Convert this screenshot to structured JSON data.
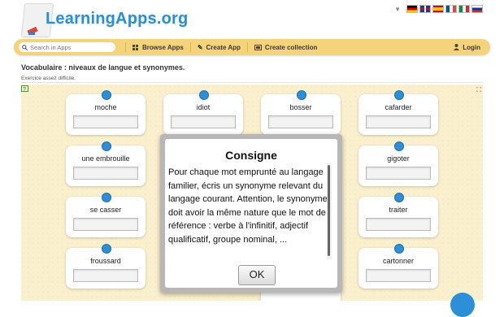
{
  "header": {
    "brand": "LearningApps.org",
    "language_flags": [
      "german-flag",
      "uk-flag",
      "spanish-flag",
      "french-flag",
      "italian-flag",
      "russian-flag"
    ]
  },
  "toolbar": {
    "search_placeholder": "Search in Apps",
    "browse_label": "Browse Apps",
    "create_label": "Create App",
    "collection_label": "Create collection",
    "login_label": "Login"
  },
  "page": {
    "title": "Vocabulaire : niveaux de langue et synonymes.",
    "subtitle": "Exercice assez difficile."
  },
  "cards": [
    {
      "word": "moche"
    },
    {
      "word": "idiot"
    },
    {
      "word": "bosser"
    },
    {
      "word": "cafarder"
    },
    {
      "word": "une embrouille"
    },
    {
      "word": "gigoter"
    },
    {
      "word": "se casser"
    },
    {
      "word": "traiter"
    },
    {
      "word": "froussard"
    },
    {
      "word": "cartonner"
    }
  ],
  "dialog": {
    "title": "Consigne",
    "text": "Pour chaque mot emprunté au langage familier, écris un synonyme relevant du langage courant. Attention, le synonyme doit avoir la même nature que le mot de référence : verbe à l'infinitif, adjectif qualificatif, groupe nominal, ...",
    "ok_label": "OK"
  },
  "colors": {
    "brand": "#2a8fd6",
    "toolbar": "#f5d37a",
    "app_background": "#fbf0cd",
    "dot": "#2d8fd8"
  }
}
